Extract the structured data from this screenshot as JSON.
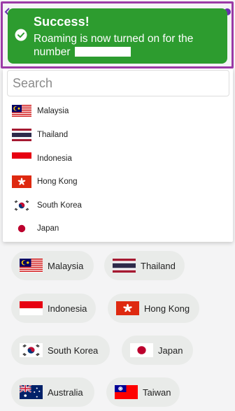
{
  "toast": {
    "title": "Success!",
    "message": "Roaming is now turned on for the number"
  },
  "search": {
    "placeholder": "Search"
  },
  "dropdown": {
    "items": [
      {
        "label": "Malaysia",
        "flag": "malaysia-flag"
      },
      {
        "label": "Thailand",
        "flag": "thailand-flag"
      },
      {
        "label": "Indonesia",
        "flag": "indonesia-flag"
      },
      {
        "label": "Hong Kong",
        "flag": "hong-kong-flag"
      },
      {
        "label": "South Korea",
        "flag": "south-korea-flag"
      },
      {
        "label": "Japan",
        "flag": "japan-flag"
      }
    ]
  },
  "chips": [
    {
      "label": "Malaysia",
      "flag": "malaysia-flag"
    },
    {
      "label": "Thailand",
      "flag": "thailand-flag"
    },
    {
      "label": "Indonesia",
      "flag": "indonesia-flag"
    },
    {
      "label": "Hong Kong",
      "flag": "hong-kong-flag"
    },
    {
      "label": "South Korea",
      "flag": "south-korea-flag"
    },
    {
      "label": "Japan",
      "flag": "japan-flag"
    },
    {
      "label": "Australia",
      "flag": "australia-flag"
    },
    {
      "label": "Taiwan",
      "flag": "taiwan-flag"
    }
  ],
  "colors": {
    "toast_bg": "#2d9c2f",
    "highlight_border": "#9b3aa6",
    "chip_bg": "#e9ebe9"
  }
}
